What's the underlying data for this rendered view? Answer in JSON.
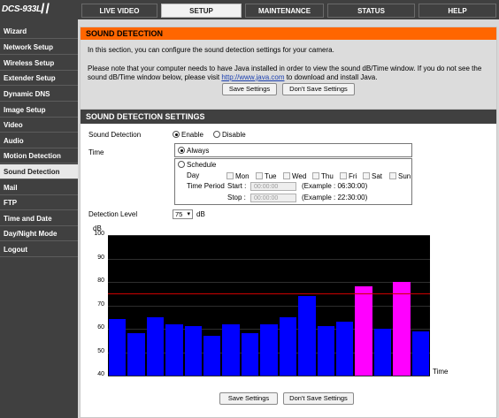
{
  "header": {
    "logo_text": "DCS-933L",
    "logo_slashes": "//",
    "tabs": [
      {
        "label": "LIVE VIDEO"
      },
      {
        "label": "SETUP"
      },
      {
        "label": "MAINTENANCE"
      },
      {
        "label": "STATUS"
      },
      {
        "label": "HELP"
      }
    ],
    "active_tab": "SETUP"
  },
  "sidebar": {
    "items": [
      {
        "label": "Wizard"
      },
      {
        "label": "Network Setup"
      },
      {
        "label": "Wireless Setup"
      },
      {
        "label": "Extender Setup"
      },
      {
        "label": "Dynamic DNS"
      },
      {
        "label": "Image Setup"
      },
      {
        "label": "Video"
      },
      {
        "label": "Audio"
      },
      {
        "label": "Motion Detection"
      },
      {
        "label": "Sound Detection"
      },
      {
        "label": "Mail"
      },
      {
        "label": "FTP"
      },
      {
        "label": "Time and Date"
      },
      {
        "label": "Day/Night Mode"
      },
      {
        "label": "Logout"
      }
    ],
    "active_item": "Sound Detection"
  },
  "info_panel": {
    "title": "SOUND DETECTION",
    "intro": "In this section, you can configure the sound detection settings for your camera.",
    "note_line1": "Please note that your computer needs to have Java installed in order to view the sound dB/Time window. If you do not see the",
    "note_line2_a": "sound dB/Time window below, please visit ",
    "note_link": "http://www.java.com",
    "note_line2_b": " to download and install Java.",
    "save_label": "Save Settings",
    "dont_save_label": "Don't Save Settings"
  },
  "settings": {
    "title": "SOUND DETECTION SETTINGS",
    "sound_detection_label": "Sound Detection",
    "enable_label": "Enable",
    "disable_label": "Disable",
    "sound_detection_value": "Enable",
    "time_label": "Time",
    "always_label": "Always",
    "schedule_label": "Schedule",
    "time_value": "Always",
    "day_label": "Day",
    "days": [
      "Mon",
      "Tue",
      "Wed",
      "Thu",
      "Fri",
      "Sat",
      "Sun"
    ],
    "time_period_label": "Time Period",
    "start_label": "Start :",
    "stop_label": "Stop :",
    "start_value": "00:00:00",
    "stop_value": "00:00:00",
    "start_example": "(Example : 06:30:00)",
    "stop_example": "(Example : 22:30:00)",
    "detection_level_label": "Detection Level",
    "detection_level_value": "75",
    "detection_level_unit": "dB"
  },
  "chart_data": {
    "type": "bar",
    "ylabel": "dB",
    "xlabel": "Time",
    "ylim": [
      40,
      100
    ],
    "yticks": [
      "100",
      "90",
      "80",
      "70",
      "60",
      "50",
      "40"
    ],
    "threshold": 75,
    "values": [
      64,
      58,
      65,
      62,
      61,
      57,
      62,
      58,
      62,
      65,
      74,
      61,
      63,
      78,
      60,
      80,
      59
    ],
    "colors": {
      "below": "#0000ff",
      "above": "#ff00ff",
      "threshold": "#cc0000",
      "background": "#000000",
      "grid": "#2e2e2e"
    }
  },
  "footer": {
    "save_label": "Save Settings",
    "dont_save_label": "Don't Save Settings"
  }
}
